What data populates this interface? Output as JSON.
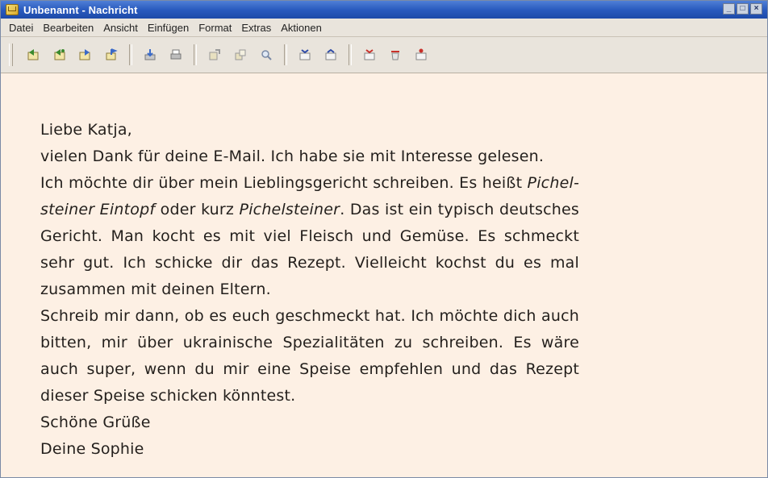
{
  "window": {
    "title": "Unbenannt - Nachricht"
  },
  "window_controls": {
    "minimize": "_",
    "maximize": "□",
    "close": "×"
  },
  "menu": {
    "items": [
      {
        "label": "Datei"
      },
      {
        "label": "Bearbeiten"
      },
      {
        "label": "Ansicht"
      },
      {
        "label": "Einfügen"
      },
      {
        "label": "Format"
      },
      {
        "label": "Extras"
      },
      {
        "label": "Aktionen"
      }
    ]
  },
  "toolbar": {
    "icons": [
      "reply-icon",
      "reply-all-icon",
      "forward-icon",
      "flag-icon",
      "save-icon",
      "print-icon",
      "move-icon",
      "copy-icon",
      "find-icon",
      "previous-icon",
      "next-icon",
      "delete-icon",
      "clear-icon",
      "mark-icon"
    ]
  },
  "message": {
    "greeting": "Liebe Katja,",
    "p1": "vielen Dank für deine E-Mail. Ich habe sie mit Interesse gelesen.",
    "p2_a": "Ich möchte dir über mein Lieblingsgericht schreiben. Es heißt ",
    "p2_em1": "Pichel-steiner Eintopf",
    "p2_b": " oder kurz ",
    "p2_em2": "Pichelsteiner",
    "p2_c": ". Das ist ein typisch deutsches Gericht. Man kocht es mit viel Fleisch und Gemüse. Es schmeckt sehr gut. Ich schicke dir das Rezept. Vielleicht kochst du es mal zusammen mit deinen Eltern.",
    "p3": "Schreib mir dann, ob es euch geschmeckt hat. Ich möchte dich auch bitten, mir über ukrainische Spezialitäten zu schreiben. Es wäre auch super, wenn du mir eine Speise empfehlen und das Rezept dieser Speise schicken könntest.",
    "closing": "Schöne Grüße",
    "signature": "Deine Sophie"
  },
  "colors": {
    "titlebar": "#2a5bbf",
    "content_background": "#fdf0e4",
    "chrome": "#e9e4dc"
  }
}
